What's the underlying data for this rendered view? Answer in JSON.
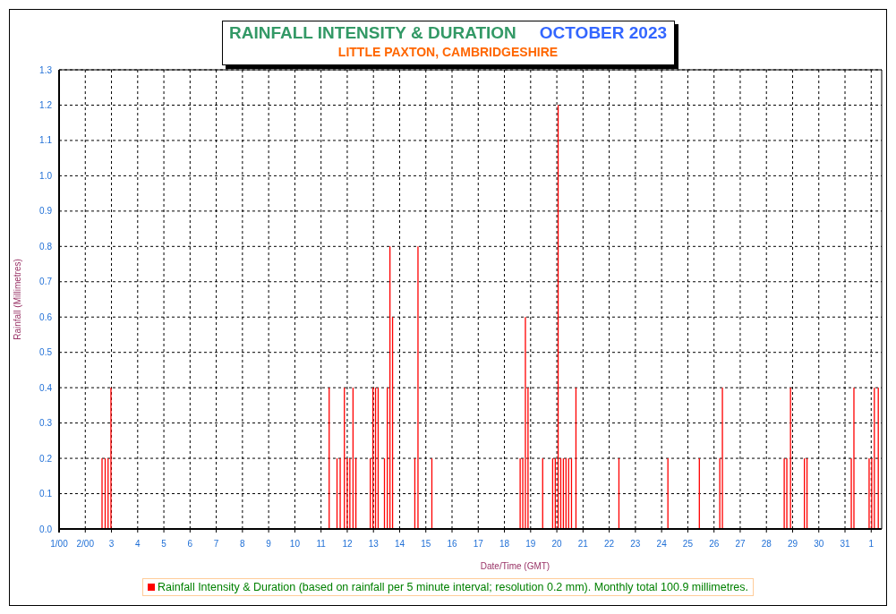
{
  "chart": {
    "title": "RAINFALL INTENSITY & DURATION",
    "period": "OCTOBER 2023",
    "subtitle": "LITTLE PAXTON, CAMBRIDGESHIRE",
    "chart_data": {
      "type": "bar",
      "xlabel": "Date/Time (GMT)",
      "ylabel": "Rainfall (Millimetres)",
      "grid": true,
      "x": [
        "2023-10-02T15:22",
        "2023-10-02T18:14",
        "2023-10-02T20:53",
        "2023-10-02T23:31",
        "2023-10-11T07:26",
        "2023-10-11T14:38",
        "2023-10-11T17:31",
        "2023-10-11T21:22",
        "2023-10-12T00:00",
        "2023-10-12T02:24",
        "2023-10-12T05:17",
        "2023-10-12T07:55",
        "2023-10-12T21:07",
        "2023-10-12T23:31",
        "2023-10-13T01:55",
        "2023-10-13T04:19",
        "2023-10-13T10:05",
        "2023-10-13T12:43",
        "2023-10-13T15:07",
        "2023-10-13T17:31",
        "2023-10-14T13:55",
        "2023-10-14T16:48",
        "2023-10-15T05:31",
        "2023-10-18T14:24",
        "2023-10-18T16:48",
        "2023-10-18T19:12",
        "2023-10-18T21:36",
        "2023-10-19T11:02",
        "2023-10-19T20:10",
        "2023-10-19T22:34",
        "2023-10-20T01:12",
        "2023-10-20T03:36",
        "2023-10-20T06:00",
        "2023-10-20T08:24",
        "2023-10-20T10:48",
        "2023-10-20T13:26",
        "2023-10-20T17:31",
        "2023-10-22T08:53",
        "2023-10-24T05:46",
        "2023-10-25T10:34",
        "2023-10-26T05:17",
        "2023-10-26T07:41",
        "2023-10-28T16:19",
        "2023-10-28T18:43",
        "2023-10-28T22:05",
        "2023-10-29T10:48",
        "2023-10-29T13:12",
        "2023-10-31T05:46",
        "2023-10-31T08:10",
        "2023-10-31T22:05",
        "2023-11-01T00:29",
        "2023-11-01T02:53",
        "2023-11-01T06:29"
      ],
      "series": [
        {
          "name": "Rainfall Intensity & Duration (based on rainfall per 5 minute interval; resolution 0.2 mm). Monthly total 100.9 millimetres.",
          "color": "#ff0000",
          "values": [
            0.2,
            0.2,
            0.2,
            0.4,
            0.4,
            0.2,
            0.2,
            0.4,
            0.2,
            0.2,
            0.4,
            0.2,
            0.2,
            0.4,
            0.4,
            0.4,
            0.2,
            0.4,
            0.8,
            0.6,
            0.2,
            0.8,
            0.2,
            0.2,
            0.2,
            0.6,
            0.4,
            0.2,
            0.2,
            0.2,
            1.2,
            0.2,
            0.2,
            0.2,
            0.2,
            0.2,
            0.4,
            0.2,
            0.2,
            0.2,
            0.2,
            0.4,
            0.2,
            0.2,
            0.4,
            0.2,
            0.2,
            0.2,
            0.4,
            0.2,
            0.2,
            0.4,
            0.4
          ]
        }
      ],
      "xlim": [
        "2023-10-01T00:00",
        "2023-11-01T09:36"
      ],
      "ylim": [
        0,
        1.3
      ],
      "xticks": [
        {
          "value": "2023-10-01T00:00",
          "label": "1/00"
        },
        {
          "value": "2023-10-02T00:00",
          "label": "2/00"
        },
        {
          "value": "2023-10-03T00:00",
          "label": "3"
        },
        {
          "value": "2023-10-04T00:00",
          "label": "4"
        },
        {
          "value": "2023-10-05T00:00",
          "label": "5"
        },
        {
          "value": "2023-10-06T00:00",
          "label": "6"
        },
        {
          "value": "2023-10-07T00:00",
          "label": "7"
        },
        {
          "value": "2023-10-08T00:00",
          "label": "8"
        },
        {
          "value": "2023-10-09T00:00",
          "label": "9"
        },
        {
          "value": "2023-10-10T00:00",
          "label": "10"
        },
        {
          "value": "2023-10-11T00:00",
          "label": "11"
        },
        {
          "value": "2023-10-12T00:00",
          "label": "12"
        },
        {
          "value": "2023-10-13T00:00",
          "label": "13"
        },
        {
          "value": "2023-10-14T00:00",
          "label": "14"
        },
        {
          "value": "2023-10-15T00:00",
          "label": "15"
        },
        {
          "value": "2023-10-16T00:00",
          "label": "16"
        },
        {
          "value": "2023-10-17T00:00",
          "label": "17"
        },
        {
          "value": "2023-10-18T00:00",
          "label": "18"
        },
        {
          "value": "2023-10-19T00:00",
          "label": "19"
        },
        {
          "value": "2023-10-20T00:00",
          "label": "20"
        },
        {
          "value": "2023-10-21T00:00",
          "label": "21"
        },
        {
          "value": "2023-10-22T00:00",
          "label": "22"
        },
        {
          "value": "2023-10-23T00:00",
          "label": "23"
        },
        {
          "value": "2023-10-24T00:00",
          "label": "24"
        },
        {
          "value": "2023-10-25T00:00",
          "label": "25"
        },
        {
          "value": "2023-10-26T00:00",
          "label": "26"
        },
        {
          "value": "2023-10-27T00:00",
          "label": "27"
        },
        {
          "value": "2023-10-28T00:00",
          "label": "28"
        },
        {
          "value": "2023-10-29T00:00",
          "label": "29"
        },
        {
          "value": "2023-10-30T00:00",
          "label": "30"
        },
        {
          "value": "2023-10-31T00:00",
          "label": "31"
        },
        {
          "value": "2023-11-01T00:00",
          "label": "1"
        }
      ],
      "yticks": [
        {
          "value": 0,
          "label": "0.0"
        },
        {
          "value": 0.1,
          "label": "0.1"
        },
        {
          "value": 0.2,
          "label": "0.2"
        },
        {
          "value": 0.3,
          "label": "0.3"
        },
        {
          "value": 0.4,
          "label": "0.4"
        },
        {
          "value": 0.5,
          "label": "0.5"
        },
        {
          "value": 0.6,
          "label": "0.6"
        },
        {
          "value": 0.7,
          "label": "0.7"
        },
        {
          "value": 0.8,
          "label": "0.8"
        },
        {
          "value": 0.9,
          "label": "0.9"
        },
        {
          "value": 1.0,
          "label": "1.0"
        },
        {
          "value": 1.1,
          "label": "1.1"
        },
        {
          "value": 1.2,
          "label": "1.2"
        },
        {
          "value": 1.3,
          "label": "1.3"
        }
      ]
    }
  }
}
